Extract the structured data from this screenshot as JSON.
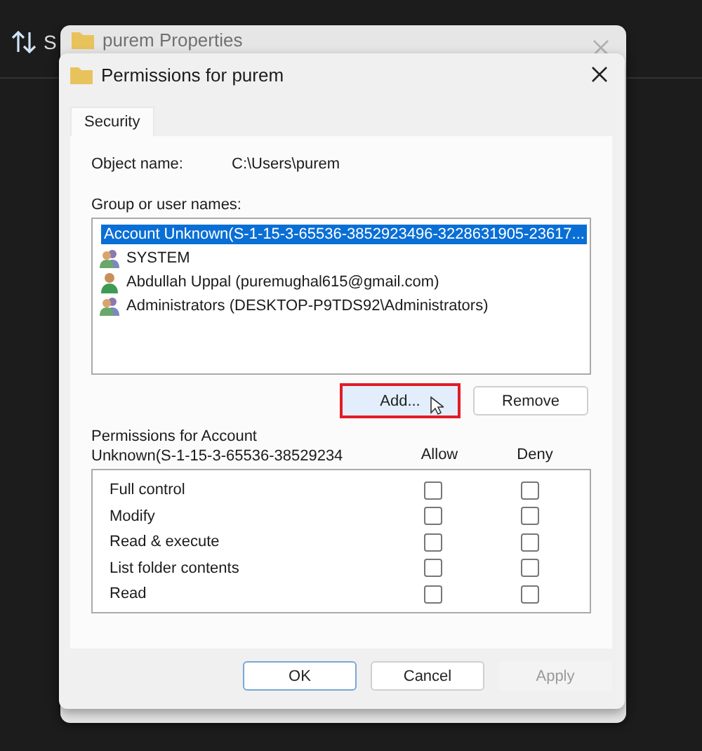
{
  "background": {
    "toolbar_label": "S"
  },
  "back_window": {
    "title": "purem Properties"
  },
  "window": {
    "title": "Permissions for purem"
  },
  "tabs": [
    {
      "label": "Security",
      "selected": true
    }
  ],
  "object_name": {
    "label": "Object name:",
    "value": "C:\\Users\\purem"
  },
  "group_list": {
    "label": "Group or user names:",
    "items": [
      {
        "name": "Account Unknown(S-1-15-3-65536-3852923496-3228631905-23617...",
        "kind": "unknown",
        "selected": true
      },
      {
        "name": "SYSTEM",
        "kind": "group",
        "selected": false
      },
      {
        "name": "Abdullah Uppal (puremughal615@gmail.com)",
        "kind": "user",
        "selected": false
      },
      {
        "name": "Administrators (DESKTOP-P9TDS92\\Administrators)",
        "kind": "group",
        "selected": false
      }
    ]
  },
  "list_buttons": [
    {
      "label": "Add...",
      "highlighted": true
    },
    {
      "label": "Remove",
      "highlighted": false
    }
  ],
  "permissions": {
    "label": "Permissions for Account Unknown(S-1-15-3-65536-38529234",
    "columns": [
      "Allow",
      "Deny"
    ],
    "rows": [
      {
        "name": "Full control",
        "allow": false,
        "deny": false
      },
      {
        "name": "Modify",
        "allow": false,
        "deny": false
      },
      {
        "name": "Read & execute",
        "allow": false,
        "deny": false
      },
      {
        "name": "List folder contents",
        "allow": false,
        "deny": false
      },
      {
        "name": "Read",
        "allow": false,
        "deny": false
      }
    ]
  },
  "buttons": [
    {
      "label": "OK",
      "disabled": false,
      "default": true
    },
    {
      "label": "Cancel",
      "disabled": false,
      "default": false
    },
    {
      "label": "Apply",
      "disabled": true,
      "default": false
    }
  ]
}
